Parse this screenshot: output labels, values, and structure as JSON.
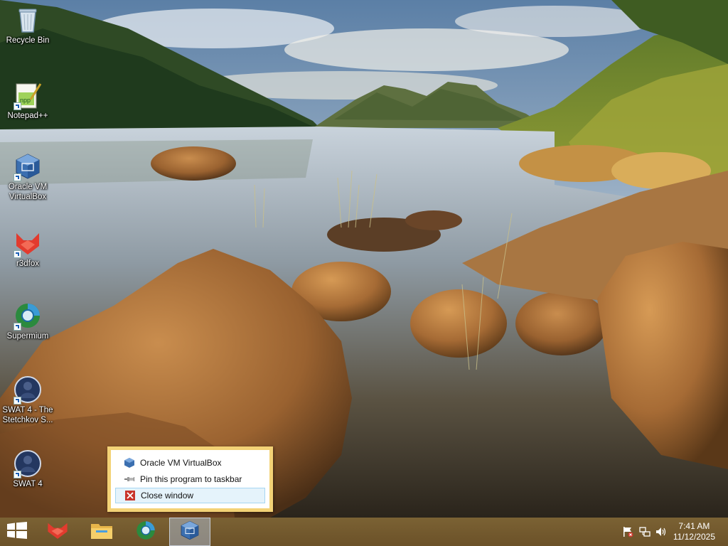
{
  "desktop": {
    "icons": [
      {
        "name": "recycle-bin",
        "label": "Recycle Bin",
        "icon": "recycle-bin-icon"
      },
      {
        "name": "notepad-plus-plus",
        "label": "Notepad++",
        "icon": "notepad-plus-plus-icon"
      },
      {
        "name": "oracle-vm-virtualbox",
        "label": "Oracle VM VirtualBox",
        "icon": "virtualbox-icon"
      },
      {
        "name": "r3dfox",
        "label": "r3dfox",
        "icon": "r3dfox-icon"
      },
      {
        "name": "supermium",
        "label": "Supermium",
        "icon": "supermium-icon"
      },
      {
        "name": "swat4-stetchkov",
        "label": "SWAT 4 - The Stetchkov S...",
        "icon": "swat4-icon"
      },
      {
        "name": "swat4",
        "label": "SWAT 4",
        "icon": "swat4-icon"
      }
    ]
  },
  "jumplist": {
    "app_label": "Oracle VM VirtualBox",
    "pin_label": "Pin this program to taskbar",
    "close_label": "Close window"
  },
  "taskbar": {
    "items": [
      "start-button",
      "r3dfox",
      "file-explorer",
      "supermium",
      "oracle-vm-virtualbox"
    ],
    "active": "oracle-vm-virtualbox"
  },
  "tray": {
    "time": "7:41 AM",
    "date": "11/12/2025",
    "icons": [
      "action-center-flag-icon",
      "network-icon",
      "volume-icon"
    ]
  },
  "colors": {
    "taskbar": "#6f552b",
    "jumplist_border": "#f3d276",
    "highlight": "#e5f3fb"
  }
}
